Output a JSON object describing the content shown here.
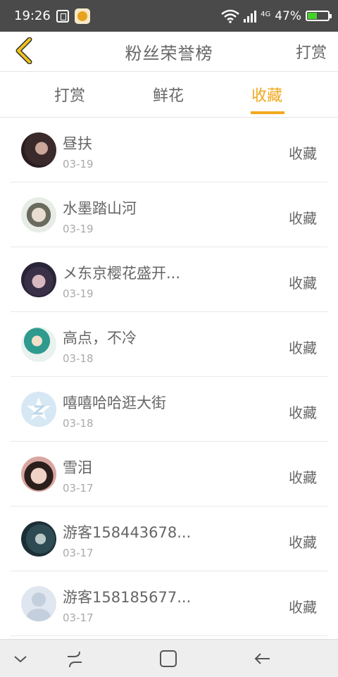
{
  "status": {
    "time": "19:26",
    "network": "4G",
    "battery_pct": "47%",
    "battery_level": 0.47
  },
  "header": {
    "title": "粉丝荣誉榜",
    "action_label": "打赏"
  },
  "tabs": [
    {
      "label": "打赏",
      "active": false
    },
    {
      "label": "鲜花",
      "active": false
    },
    {
      "label": "收藏",
      "active": true
    }
  ],
  "fans": [
    {
      "name": "昼扶",
      "date": "03-19",
      "action": "收藏"
    },
    {
      "name": "水墨踏山河",
      "date": "03-19",
      "action": "收藏"
    },
    {
      "name": "メ东京樱花盛开...",
      "date": "03-19",
      "action": "收藏"
    },
    {
      "name": "高点，不冷",
      "date": "03-18",
      "action": "收藏"
    },
    {
      "name": "嘻嘻哈哈逛大街",
      "date": "03-18",
      "action": "收藏"
    },
    {
      "name": "雪泪",
      "date": "03-17",
      "action": "收藏"
    },
    {
      "name": "游客158443678...",
      "date": "03-17",
      "action": "收藏"
    },
    {
      "name": "游客158185677...",
      "date": "03-17",
      "action": "收藏"
    }
  ],
  "colors": {
    "accent": "#f0a81e",
    "back_arrow": "#f0c419",
    "text": "#666666",
    "subtext": "#aaaaaa"
  }
}
